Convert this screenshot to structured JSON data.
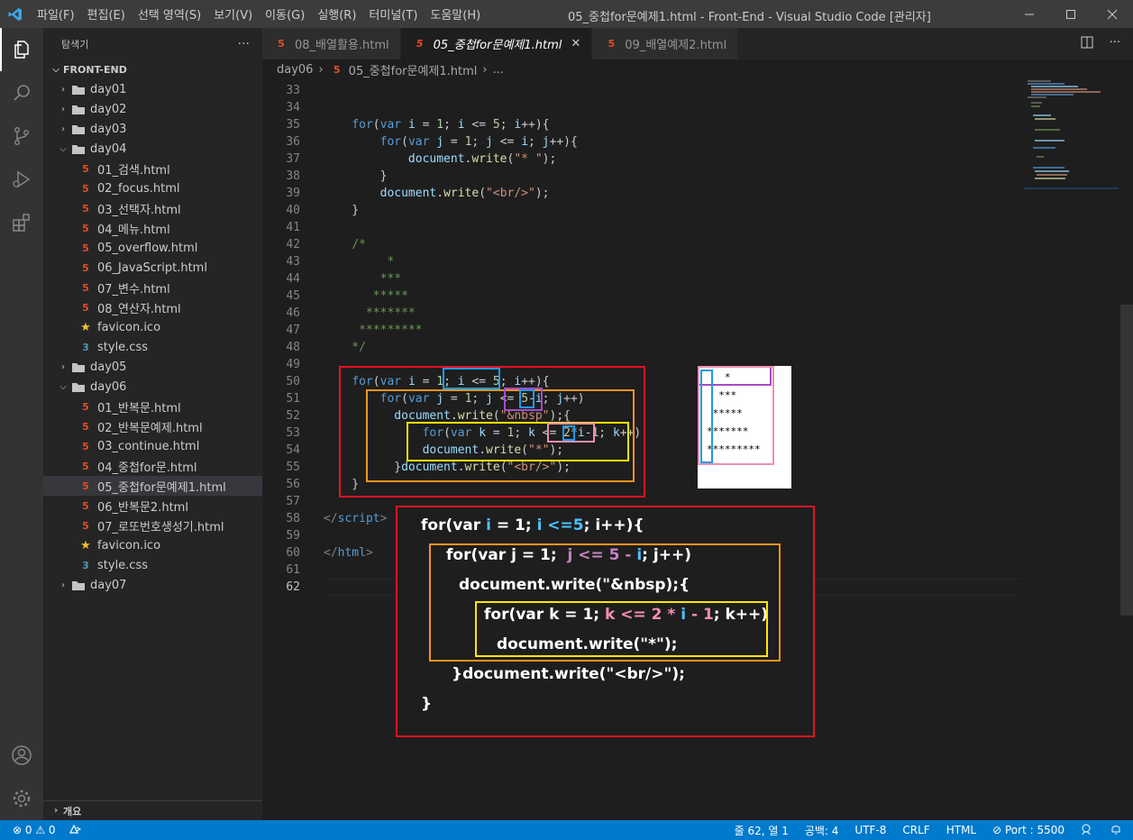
{
  "titlebar": {
    "menu": [
      "파일(F)",
      "편집(E)",
      "선택 영역(S)",
      "보기(V)",
      "이동(G)",
      "실행(R)",
      "터미널(T)",
      "도움말(H)"
    ],
    "title": "05_중첩for문예제1.html - Front-End - Visual Studio Code [관리자]"
  },
  "sidebar": {
    "title": "탐색기",
    "more": "···",
    "root": "FRONT-END",
    "items": [
      {
        "label": "day01",
        "kind": "folder",
        "open": false,
        "depth": 1
      },
      {
        "label": "day02",
        "kind": "folder",
        "open": false,
        "depth": 1
      },
      {
        "label": "day03",
        "kind": "folder",
        "open": false,
        "depth": 1
      },
      {
        "label": "day04",
        "kind": "folder",
        "open": true,
        "depth": 1
      },
      {
        "label": "01_검색.html",
        "kind": "html",
        "depth": 2
      },
      {
        "label": "02_focus.html",
        "kind": "html",
        "depth": 2
      },
      {
        "label": "03_선택자.html",
        "kind": "html",
        "depth": 2
      },
      {
        "label": "04_메뉴.html",
        "kind": "html",
        "depth": 2
      },
      {
        "label": "05_overflow.html",
        "kind": "html",
        "depth": 2
      },
      {
        "label": "06_JavaScript.html",
        "kind": "html",
        "depth": 2
      },
      {
        "label": "07_변수.html",
        "kind": "html",
        "depth": 2
      },
      {
        "label": "08_연산자.html",
        "kind": "html",
        "depth": 2
      },
      {
        "label": "favicon.ico",
        "kind": "star",
        "depth": 2
      },
      {
        "label": "style.css",
        "kind": "css",
        "depth": 2
      },
      {
        "label": "day05",
        "kind": "folder",
        "open": false,
        "depth": 1
      },
      {
        "label": "day06",
        "kind": "folder",
        "open": true,
        "depth": 1
      },
      {
        "label": "01_반복문.html",
        "kind": "html",
        "depth": 2
      },
      {
        "label": "02_반복문예제.html",
        "kind": "html",
        "depth": 2
      },
      {
        "label": "03_continue.html",
        "kind": "html",
        "depth": 2
      },
      {
        "label": "04_중첩for문.html",
        "kind": "html",
        "depth": 2
      },
      {
        "label": "05_중첩for문예제1.html",
        "kind": "html",
        "depth": 2,
        "selected": true
      },
      {
        "label": "06_반복문2.html",
        "kind": "html",
        "depth": 2
      },
      {
        "label": "07_로또번호생성기.html",
        "kind": "html",
        "depth": 2
      },
      {
        "label": "favicon.ico",
        "kind": "star",
        "depth": 2
      },
      {
        "label": "style.css",
        "kind": "css",
        "depth": 2
      },
      {
        "label": "day07",
        "kind": "folder",
        "open": false,
        "depth": 1
      }
    ],
    "outline": "개요"
  },
  "tabs": [
    {
      "label": "08_배열활용.html",
      "active": false
    },
    {
      "label": "05_중첩for문예제1.html",
      "active": true
    },
    {
      "label": "09_배열예제2.html",
      "active": false
    }
  ],
  "breadcrumb": {
    "folder": "day06",
    "file": "05_중첩for문예제1.html",
    "more": "..."
  },
  "editor": {
    "lines": [
      {
        "n": "33",
        "html": ""
      },
      {
        "n": "34",
        "html": ""
      },
      {
        "n": "35",
        "html": "    <span class='kw'>for</span>(<span class='kw'>var</span> <span class='var'>i</span> = <span class='num'>1</span>; <span class='var'>i</span> &lt;= <span class='num'>5</span>; <span class='var'>i</span>++){"
      },
      {
        "n": "36",
        "html": "        <span class='kw'>for</span>(<span class='kw'>var</span> <span class='var'>j</span> = <span class='num'>1</span>; <span class='var'>j</span> &lt;= <span class='var'>i</span>; <span class='var'>j</span>++){"
      },
      {
        "n": "37",
        "html": "            <span class='var'>document</span>.<span class='fn'>write</span>(<span class='str'>\"* \"</span>);"
      },
      {
        "n": "38",
        "html": "        }"
      },
      {
        "n": "39",
        "html": "        <span class='var'>document</span>.<span class='fn'>write</span>(<span class='str'>\"&lt;br/&gt;\"</span>);"
      },
      {
        "n": "40",
        "html": "    }"
      },
      {
        "n": "41",
        "html": ""
      },
      {
        "n": "42",
        "html": "    <span class='cmt'>/*</span>"
      },
      {
        "n": "43",
        "html": "<span class='cmt'>         *</span>"
      },
      {
        "n": "44",
        "html": "<span class='cmt'>        ***</span>"
      },
      {
        "n": "45",
        "html": "<span class='cmt'>       *****</span>"
      },
      {
        "n": "46",
        "html": "<span class='cmt'>      *******</span>"
      },
      {
        "n": "47",
        "html": "<span class='cmt'>     *********</span>"
      },
      {
        "n": "48",
        "html": "<span class='cmt'>    */</span>"
      },
      {
        "n": "49",
        "html": ""
      },
      {
        "n": "50",
        "html": "    <span class='kw'>for</span>(<span class='kw'>var</span> <span class='var'>i</span> = <span class='num'>1</span>; <span class='var'>i</span> &lt;= <span class='num'>5</span>; <span class='var'>i</span>++){"
      },
      {
        "n": "51",
        "html": "        <span class='kw'>for</span>(<span class='kw'>var</span> <span class='var'>j</span> = <span class='num'>1</span>; <span class='var'>j</span> &lt;= <span class='num'>5</span>-<span class='var'>i</span>; <span class='var'>j</span>++)"
      },
      {
        "n": "52",
        "html": "          <span class='var'>document</span>.<span class='fn'>write</span>(<span class='str'>\"&amp;nbsp\"</span>);{"
      },
      {
        "n": "53",
        "html": "              <span class='kw'>for</span>(<span class='kw'>var</span> <span class='var'>k</span> = <span class='num'>1</span>; <span class='var'>k</span> &lt;= <span class='num'>2</span>*<span class='var'>i</span>-<span class='num'>1</span>; <span class='var'>k</span>++)"
      },
      {
        "n": "54",
        "html": "              <span class='var'>document</span>.<span class='fn'>write</span>(<span class='str'>\"*\"</span>);"
      },
      {
        "n": "55",
        "html": "          }<span class='var'>document</span>.<span class='fn'>write</span>(<span class='str'>\"&lt;br/&gt;\"</span>);"
      },
      {
        "n": "56",
        "html": "    }"
      },
      {
        "n": "57",
        "html": ""
      },
      {
        "n": "58",
        "html": "<span class='tag'>&lt;/</span><span class='tagn'>script</span><span class='tag'>&gt;</span>"
      },
      {
        "n": "59",
        "html": ""
      },
      {
        "n": "60",
        "html": "<span class='tag'>&lt;/</span><span class='tagn'>html</span><span class='tag'>&gt;</span>"
      },
      {
        "n": "61",
        "html": ""
      },
      {
        "n": "62",
        "html": ""
      }
    ]
  },
  "preview": {
    "lines": [
      "   *",
      "  ***",
      " *****",
      "*******",
      "*********"
    ]
  },
  "annotation": {
    "lines": [
      "<span>for(var </span><span class='bl'>i</span><span> = 1; </span><span class='bl'>i</span><span class='bl'> &lt;=5</span><span>; i++){</span>",
      "<span>for(var j = 1;  </span><span class='pk'>j &lt;= 5 - </span><span class='bl'>i</span><span>; j++)</span>",
      "<span>document.write(\"&amp;nbsp);{</span>",
      "<span>for(var k = 1; </span><span class='pinkc'>k &lt;= 2 * </span><span class='bl'>i</span><span class='pinkc'> - 1</span><span>; k++)</span>",
      "<span>document.write(\"*\");</span>",
      "<span>}document.write(\"&lt;br/&gt;\");</span>",
      "<span>}</span>"
    ]
  },
  "statusbar": {
    "problems": "⊗ 0 ⚠ 0",
    "position": "줄 62, 열 1",
    "spaces": "공백: 4",
    "encoding": "UTF-8",
    "eol": "CRLF",
    "language": "HTML",
    "port": "⊘ Port : 5500"
  },
  "colors": {
    "accent": "#007acc",
    "red_box": "#e81123",
    "orange_box": "#f7941d",
    "yellow_box": "#ffe600",
    "blue_box": "#1e9be9",
    "purple_box": "#a74ac7",
    "pink_box": "#f48fb1"
  }
}
